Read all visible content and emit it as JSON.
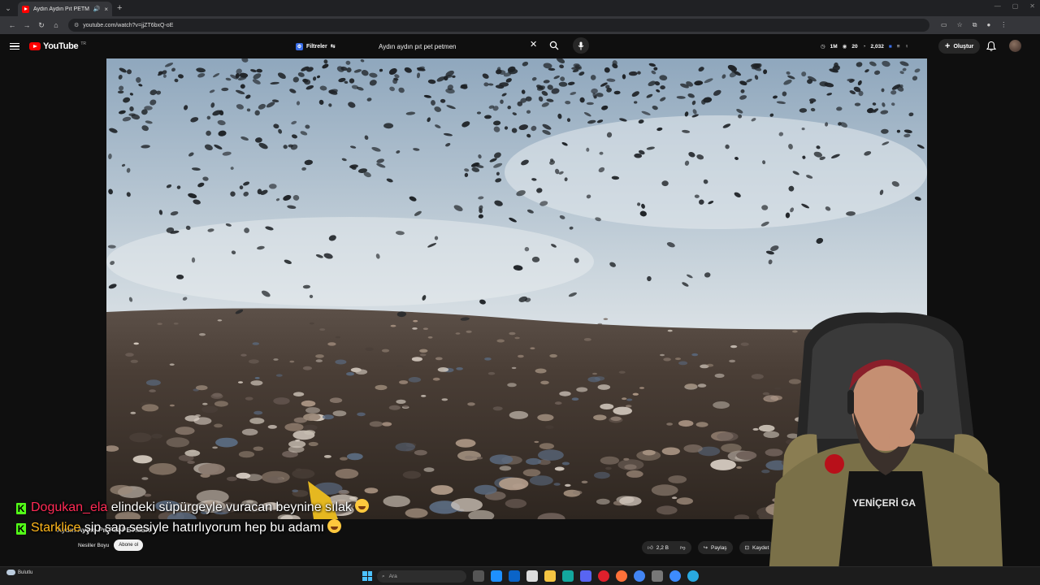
{
  "browser": {
    "tab_title": "Aydın Aydın Pıt PETMEN",
    "url": "youtube.com/watch?v=jjZT6bxQ-oE"
  },
  "youtube": {
    "logo_text": "YouTube",
    "country_code": "TR",
    "filter_label": "Filtreler",
    "search_value": "Aydın aydın pıt pet petmen",
    "stats": [
      "1M",
      "20",
      "2,032"
    ],
    "create_label": "Oluştur"
  },
  "video": {
    "title": "Aydın Aydın Pıt Pet PETMEN",
    "channel": "Nesiller Boyu",
    "subscribe_label": "Abone ol",
    "likes": "2,2 B",
    "share_label": "Paylaş",
    "save_label": "Kaydet"
  },
  "chat": [
    {
      "user": "Dogukan_ela",
      "message": "elindeki süpürgeyle vuracan beynine sılak"
    },
    {
      "user": "Starklice",
      "message": "şip şap sesiyle hatırlıyorum hep bu adamı"
    }
  ],
  "taskbar": {
    "weather": "Bulutlu",
    "search_placeholder": "Ara"
  },
  "colors": {
    "youtube_red": "#ff0000",
    "kick_green": "#53fc18",
    "chat_user_1": "#ff2a55",
    "chat_user_2": "#ffb71a"
  }
}
